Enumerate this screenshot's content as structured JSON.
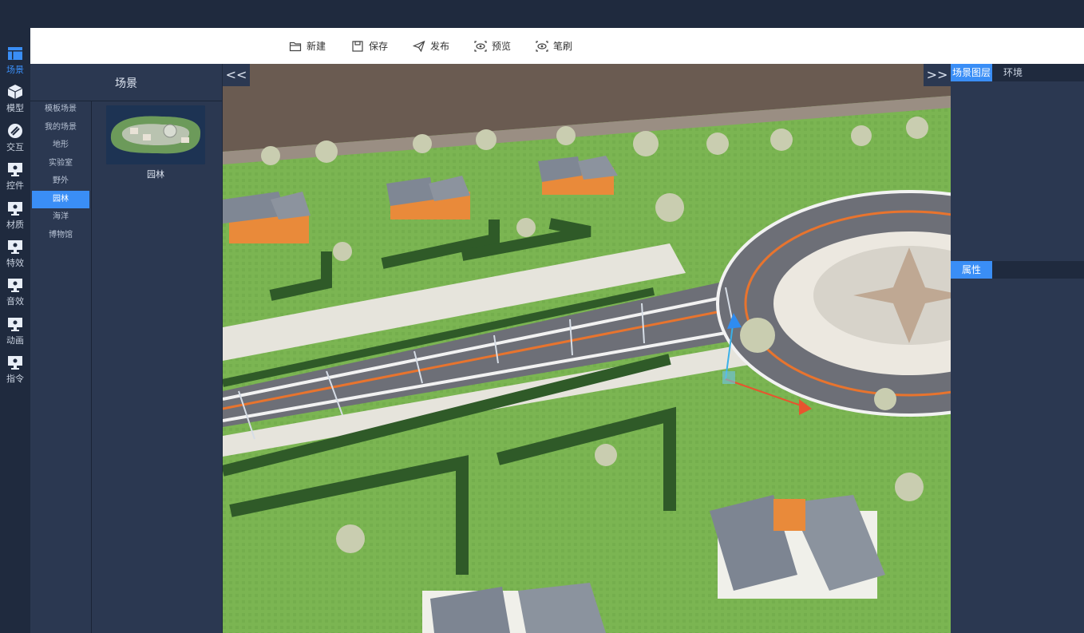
{
  "nav": {
    "items": [
      {
        "label": "场景",
        "icon": "scene-icon",
        "active": true
      },
      {
        "label": "模型",
        "icon": "model-cube-icon"
      },
      {
        "label": "交互",
        "icon": "interaction-icon"
      },
      {
        "label": "控件",
        "icon": "widget-icon"
      },
      {
        "label": "材质",
        "icon": "material-icon"
      },
      {
        "label": "特效",
        "icon": "effects-icon"
      },
      {
        "label": "音效",
        "icon": "sound-icon"
      },
      {
        "label": "动画",
        "icon": "animation-icon"
      },
      {
        "label": "指令",
        "icon": "command-icon"
      }
    ]
  },
  "toolbar": {
    "new_label": "新建",
    "save_label": "保存",
    "publish_label": "发布",
    "preview_label": "预览",
    "brush_label": "笔刷"
  },
  "category_panel": {
    "title": "场景",
    "items": [
      "模板场景",
      "我的场景",
      "地形",
      "实验室",
      "野外",
      "园林",
      "海洋",
      "博物馆"
    ],
    "active_index": 5,
    "thumbnail_label": "园林"
  },
  "left_collapse": "<<",
  "right_collapse": ">>",
  "right_panel": {
    "tabs": [
      "场景图层",
      "环境"
    ],
    "active_tab": 0,
    "properties_label": "属性"
  },
  "colors": {
    "accent": "#3a8ef6",
    "panel": "#2b3851",
    "dark": "#1f2a3e"
  }
}
